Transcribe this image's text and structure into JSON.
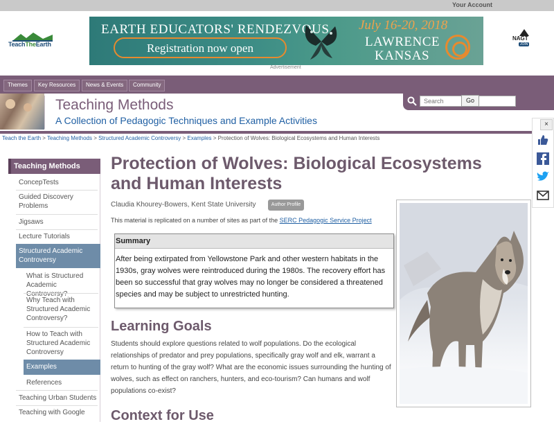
{
  "account": {
    "label": "Your Account"
  },
  "logo": {
    "part1": "Teach",
    "part2": "The",
    "part3": "Earth"
  },
  "banner": {
    "line1": "EARTH EDUCATORS' RENDEZVOUS",
    "line2": "Registration now open",
    "date": "July 16-20, 2018",
    "city1": "LAWRENCE",
    "city2": "KANSAS",
    "ad_label": "Advertisement"
  },
  "nagt": {
    "name": "NAGT",
    "join": "JOIN"
  },
  "nav": {
    "items": [
      {
        "label": "Themes"
      },
      {
        "label": "Key Resources"
      },
      {
        "label": "News & Events"
      },
      {
        "label": "Community"
      }
    ]
  },
  "section": {
    "title": "Teaching Methods",
    "subtitle": "A Collection of Pedagogic Techniques and Example Activities"
  },
  "search": {
    "placeholder": "Search",
    "go_label": "Go"
  },
  "breadcrumb": {
    "items": [
      "Teach the Earth",
      "Teaching Methods",
      "Structured Academic Controversy",
      "Examples"
    ],
    "current": "Protection of Wolves: Biological Ecosystems and Human Interests",
    "sep": " > "
  },
  "sidebar": {
    "heading": "Teaching Methods",
    "items": [
      {
        "label": "ConcepTests"
      },
      {
        "label": "Guided Discovery Problems"
      },
      {
        "label": "Jigsaws"
      },
      {
        "label": "Lecture Tutorials"
      },
      {
        "label": "Structured Academic Controversy"
      },
      {
        "label": "What is Structured Academic Controversy?"
      },
      {
        "label": "Why Teach with Structured Academic Controversy?"
      },
      {
        "label": "How to Teach with Structured Academic Controversy"
      },
      {
        "label": "Examples"
      },
      {
        "label": "References"
      },
      {
        "label": "Teaching Urban Students"
      },
      {
        "label": "Teaching with Google"
      }
    ]
  },
  "page": {
    "title": "Protection of Wolves: Biological Ecosystems and Human Interests",
    "author": "Claudia Khourey-Bowers, Kent State University",
    "author_badge": "Author Profile",
    "replicated_prefix": "This material is replicated on a number of sites as part of the ",
    "replicated_link": "SERC Pedagogic Service Project",
    "summary_head": "Summary",
    "summary_body": "After being extirpated from Yellowstone Park and other western habitats in the 1930s, gray wolves were reintroduced during the 1980s. The recovery effort has been so successful that gray wolves may no longer be considered a threatened species and may be subject to unrestricted hunting.",
    "learning_goals_title": "Learning Goals",
    "learning_goals_body": "Students should explore questions related to wolf populations. Do the ecological relationships of predator and prey populations, specifically gray wolf and elk, warrant a return to hunting of the gray wolf? What are the economic issues surrounding the hunting of wolves, such as effect on ranchers, hunters, and eco-tourism? Can humans and wolf populations co-exist?",
    "context_title": "Context for Use"
  },
  "share": {
    "close": "×"
  }
}
